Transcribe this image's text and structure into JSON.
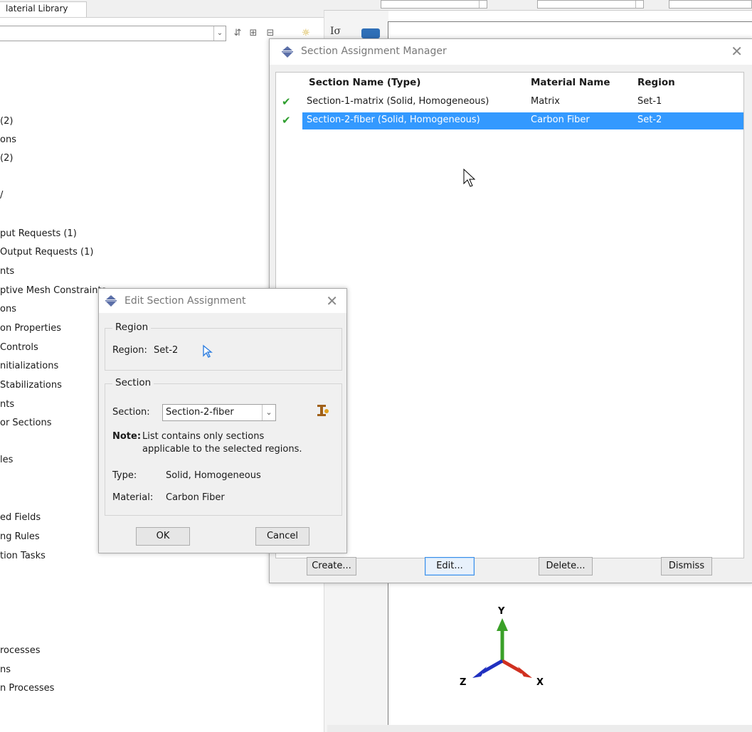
{
  "left_panel": {
    "tab_label": "laterial Library",
    "tree_items": [
      "(2)",
      "ons",
      "(2)",
      "/",
      "put Requests (1)",
      "Output Requests (1)",
      "nts",
      "ptive Mesh Constraints",
      "ons",
      "on Properties",
      "Controls",
      "nitializations",
      "Stabilizations",
      "nts",
      "or Sections",
      "les",
      "ed Fields",
      "ng Rules",
      "tion Tasks",
      "rocesses",
      "ns",
      "n Processes"
    ]
  },
  "section_assignment_manager": {
    "title": "Section Assignment Manager",
    "columns": [
      "Section Name (Type)",
      "Material Name",
      "Region"
    ],
    "rows": [
      {
        "section": "Section-1-matrix (Solid, Homogeneous)",
        "material": "Matrix",
        "region": "Set-1",
        "selected": false
      },
      {
        "section": "Section-2-fiber (Solid, Homogeneous)",
        "material": "Carbon Fiber",
        "region": "Set-2",
        "selected": true
      }
    ],
    "buttons": {
      "create": "Create...",
      "edit": "Edit...",
      "delete": "Delete...",
      "dismiss": "Dismiss"
    }
  },
  "edit_section_assignment": {
    "title": "Edit Section Assignment",
    "region_group": "Region",
    "region_label": "Region:",
    "region_value": "Set-2",
    "section_group": "Section",
    "section_label": "Section:",
    "section_value": "Section-2-fiber",
    "note_label": "Note:",
    "note_line1": "List contains only sections",
    "note_line2": "applicable to the selected regions.",
    "type_label": "Type:",
    "type_value": "Solid, Homogeneous",
    "material_label": "Material:",
    "material_value": "Carbon Fiber",
    "ok": "OK",
    "cancel": "Cancel"
  },
  "triad": {
    "y": "Y",
    "x": "X",
    "z": "Z"
  },
  "colors": {
    "selection": "#3399ff",
    "check": "#2e9e2e",
    "axis_x": "#d03020",
    "axis_y": "#3aa028",
    "axis_z": "#2030c0"
  }
}
